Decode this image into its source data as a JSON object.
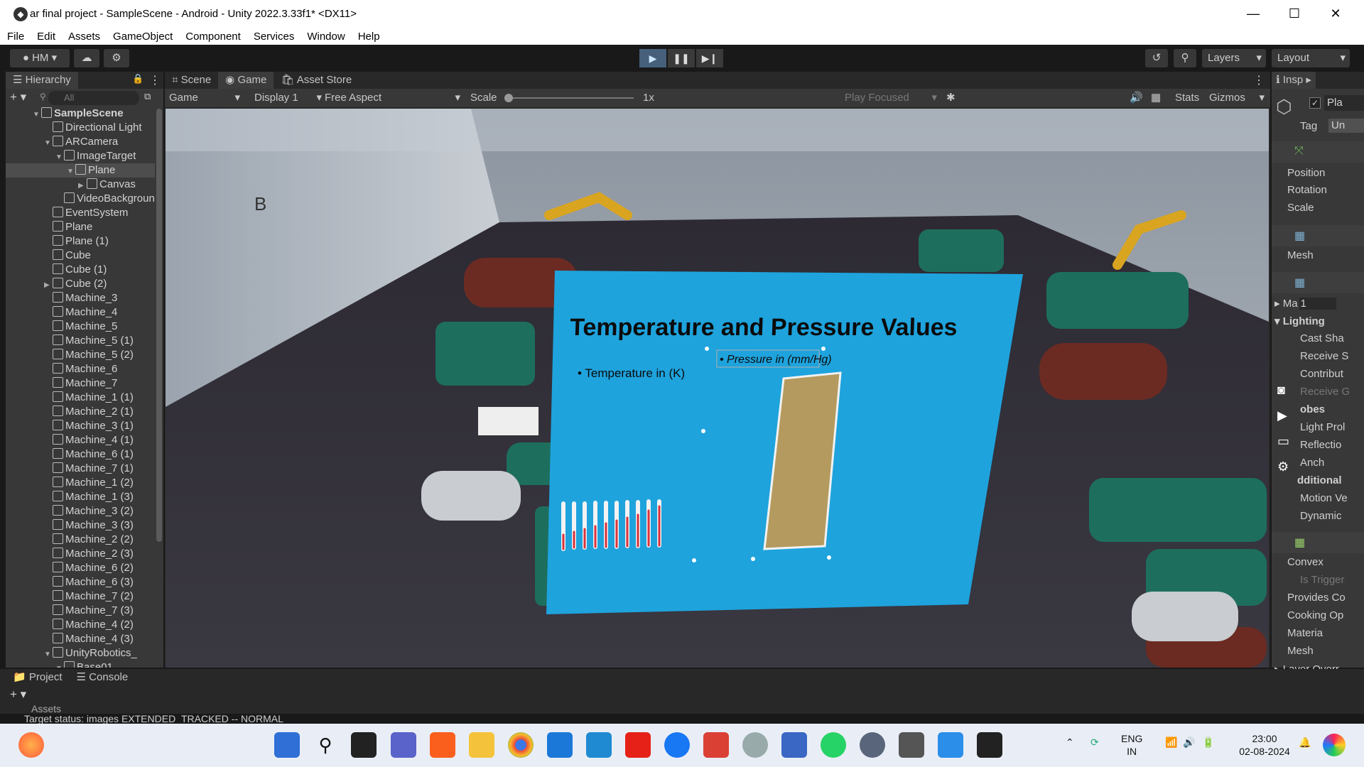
{
  "window": {
    "title": "ar final project - SampleScene - Android - Unity 2022.3.33f1* <DX11>",
    "minimize": "—",
    "maximize": "☐",
    "close": "✕"
  },
  "menu": [
    "File",
    "Edit",
    "Assets",
    "GameObject",
    "Component",
    "Services",
    "Window",
    "Help"
  ],
  "toolbar": {
    "account": "HM",
    "layers": "Layers",
    "layout": "Layout",
    "play_icon": "▶",
    "pause_icon": "❚❚",
    "step_icon": "▶❙"
  },
  "hierarchy": {
    "tab": "Hierarchy",
    "search_placeholder": "All",
    "items": [
      {
        "label": "SampleScene",
        "indent": 0,
        "arrow": "▼",
        "bold": true
      },
      {
        "label": "Directional Light",
        "indent": 1,
        "arrow": ""
      },
      {
        "label": "ARCamera",
        "indent": 1,
        "arrow": "▼"
      },
      {
        "label": "ImageTarget",
        "indent": 2,
        "arrow": "▼"
      },
      {
        "label": "Plane",
        "indent": 3,
        "arrow": "▼",
        "selected": true
      },
      {
        "label": "Canvas",
        "indent": 4,
        "arrow": "▶"
      },
      {
        "label": "VideoBackground",
        "indent": 2,
        "arrow": ""
      },
      {
        "label": "EventSystem",
        "indent": 1,
        "arrow": ""
      },
      {
        "label": "Plane",
        "indent": 1,
        "arrow": ""
      },
      {
        "label": "Plane (1)",
        "indent": 1,
        "arrow": ""
      },
      {
        "label": "Cube",
        "indent": 1,
        "arrow": ""
      },
      {
        "label": "Cube (1)",
        "indent": 1,
        "arrow": ""
      },
      {
        "label": "Cube (2)",
        "indent": 1,
        "arrow": "▶"
      },
      {
        "label": "Machine_3",
        "indent": 1,
        "arrow": ""
      },
      {
        "label": "Machine_4",
        "indent": 1,
        "arrow": ""
      },
      {
        "label": "Machine_5",
        "indent": 1,
        "arrow": ""
      },
      {
        "label": "Machine_5 (1)",
        "indent": 1,
        "arrow": ""
      },
      {
        "label": "Machine_5 (2)",
        "indent": 1,
        "arrow": ""
      },
      {
        "label": "Machine_6",
        "indent": 1,
        "arrow": ""
      },
      {
        "label": "Machine_7",
        "indent": 1,
        "arrow": ""
      },
      {
        "label": "Machine_1 (1)",
        "indent": 1,
        "arrow": ""
      },
      {
        "label": "Machine_2 (1)",
        "indent": 1,
        "arrow": ""
      },
      {
        "label": "Machine_3 (1)",
        "indent": 1,
        "arrow": ""
      },
      {
        "label": "Machine_4 (1)",
        "indent": 1,
        "arrow": ""
      },
      {
        "label": "Machine_6 (1)",
        "indent": 1,
        "arrow": ""
      },
      {
        "label": "Machine_7 (1)",
        "indent": 1,
        "arrow": ""
      },
      {
        "label": "Machine_1 (2)",
        "indent": 1,
        "arrow": ""
      },
      {
        "label": "Machine_1 (3)",
        "indent": 1,
        "arrow": ""
      },
      {
        "label": "Machine_3 (2)",
        "indent": 1,
        "arrow": ""
      },
      {
        "label": "Machine_3 (3)",
        "indent": 1,
        "arrow": ""
      },
      {
        "label": "Machine_2 (2)",
        "indent": 1,
        "arrow": ""
      },
      {
        "label": "Machine_2 (3)",
        "indent": 1,
        "arrow": ""
      },
      {
        "label": "Machine_6 (2)",
        "indent": 1,
        "arrow": ""
      },
      {
        "label": "Machine_6 (3)",
        "indent": 1,
        "arrow": ""
      },
      {
        "label": "Machine_7 (2)",
        "indent": 1,
        "arrow": ""
      },
      {
        "label": "Machine_7 (3)",
        "indent": 1,
        "arrow": ""
      },
      {
        "label": "Machine_4 (2)",
        "indent": 1,
        "arrow": ""
      },
      {
        "label": "Machine_4 (3)",
        "indent": 1,
        "arrow": ""
      },
      {
        "label": "UnityRobotics_",
        "indent": 1,
        "arrow": "▼"
      },
      {
        "label": "Base01",
        "indent": 2,
        "arrow": "▼"
      }
    ]
  },
  "center_tabs": {
    "scene": "Scene",
    "game": "Game",
    "asset_store": "Asset Store"
  },
  "game_toolbar": {
    "mode": "Game",
    "display": "Display 1",
    "aspect": "Free Aspect",
    "scale_label": "Scale",
    "scale_value": "1x",
    "play_focused": "Play Focused",
    "stats": "Stats",
    "gizmos": "Gizmos"
  },
  "ar_panel": {
    "heading": "Temperature and Pressure Values",
    "temperature": "• Temperature in (K)",
    "pressure": "• Pressure in (mm/Hg)",
    "wall_letter": "B"
  },
  "inspector": {
    "tab": "Insp",
    "name_value": "Pla",
    "tag_label": "Tag",
    "tag_value": "Un",
    "rows": [
      "Position",
      "Rotation",
      "Scale",
      "Mesh",
      "Ma",
      "Lighting",
      "Cast Sha",
      "Receive S",
      "Contribut",
      "Receive G",
      "obes",
      "Light Prol",
      "Reflectio",
      "Anch",
      "dditional",
      "Motion Ve",
      "Dynamic",
      "Convex",
      "Is Trigger",
      "Provides Co",
      "Cooking Op",
      "Materia",
      "Mesh",
      "Layer Overr"
    ],
    "ma_value": "1"
  },
  "bottom": {
    "project": "Project",
    "console": "Console",
    "assets": "Assets",
    "status": "Target status: images EXTENDED_TRACKED -- NORMAL"
  },
  "taskbar": {
    "lang_top": "ENG",
    "lang_bottom": "IN",
    "time": "23:00",
    "date": "02-08-2024"
  }
}
